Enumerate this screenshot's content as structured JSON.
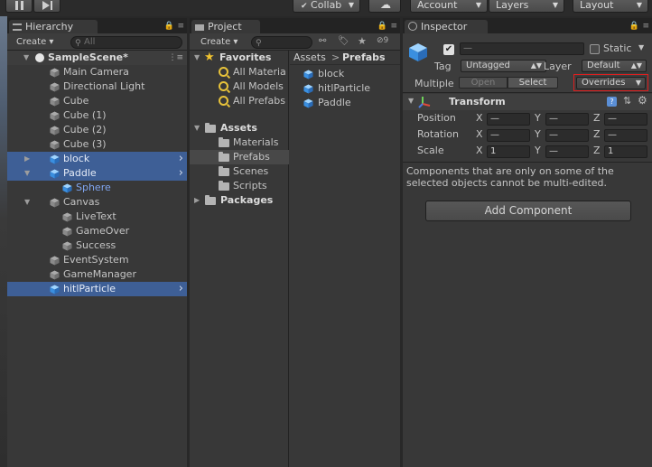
{
  "toolbar": {
    "pause_icon": "pause-icon",
    "step_icon": "step-icon",
    "collab": "Collab",
    "cloud_icon": "cloud-icon",
    "account": "Account",
    "layers": "Layers",
    "layout": "Layout"
  },
  "hierarchy": {
    "tab": "Hierarchy",
    "create": "Create",
    "search_placeholder": "All",
    "scene": "SampleScene*",
    "items": [
      {
        "label": "Main Camera"
      },
      {
        "label": "Directional Light"
      },
      {
        "label": "Cube"
      },
      {
        "label": "Cube (1)"
      },
      {
        "label": "Cube (2)"
      },
      {
        "label": "Cube (3)"
      },
      {
        "label": "block"
      },
      {
        "label": "Paddle"
      },
      {
        "label": "Sphere"
      },
      {
        "label": "Canvas"
      },
      {
        "label": "LiveText"
      },
      {
        "label": "GameOver"
      },
      {
        "label": "Success"
      },
      {
        "label": "EventSystem"
      },
      {
        "label": "GameManager"
      },
      {
        "label": "hitlParticle"
      }
    ]
  },
  "project": {
    "tab": "Project",
    "create": "Create",
    "hidden_count": "9",
    "favorites": "Favorites",
    "fav_items": [
      "All Materia",
      "All Models",
      "All Prefabs"
    ],
    "assets": "Assets",
    "asset_folders": [
      "Materials",
      "Prefabs",
      "Scenes",
      "Scripts"
    ],
    "packages": "Packages",
    "breadcrumb_root": "Assets",
    "breadcrumb_sep": ">",
    "breadcrumb_current": "Prefabs",
    "prefabs": [
      "block",
      "hitlParticle",
      "Paddle"
    ]
  },
  "inspector": {
    "tab": "Inspector",
    "name_value": "—",
    "static_label": "Static",
    "tag_label": "Tag",
    "tag_value": "Untagged",
    "layer_label": "Layer",
    "layer_value": "Default",
    "multiple_label": "Multiple",
    "open_button": "Open",
    "select_button": "Select",
    "overrides": "Overrides",
    "transform_title": "Transform",
    "position_label": "Position",
    "rotation_label": "Rotation",
    "scale_label": "Scale",
    "axis_x": "X",
    "axis_y": "Y",
    "axis_z": "Z",
    "position": [
      "—",
      "—",
      "—"
    ],
    "rotation": [
      "—",
      "—",
      "—"
    ],
    "scale": [
      "1",
      "—",
      "1"
    ],
    "notice": "Components that are only on some of the selected objects cannot be multi-edited.",
    "add_component": "Add Component"
  },
  "colors": {
    "selection": "#3e5f96",
    "prefab_text": "#7fa5f0",
    "overrides_highlight": "#e01e1e"
  }
}
